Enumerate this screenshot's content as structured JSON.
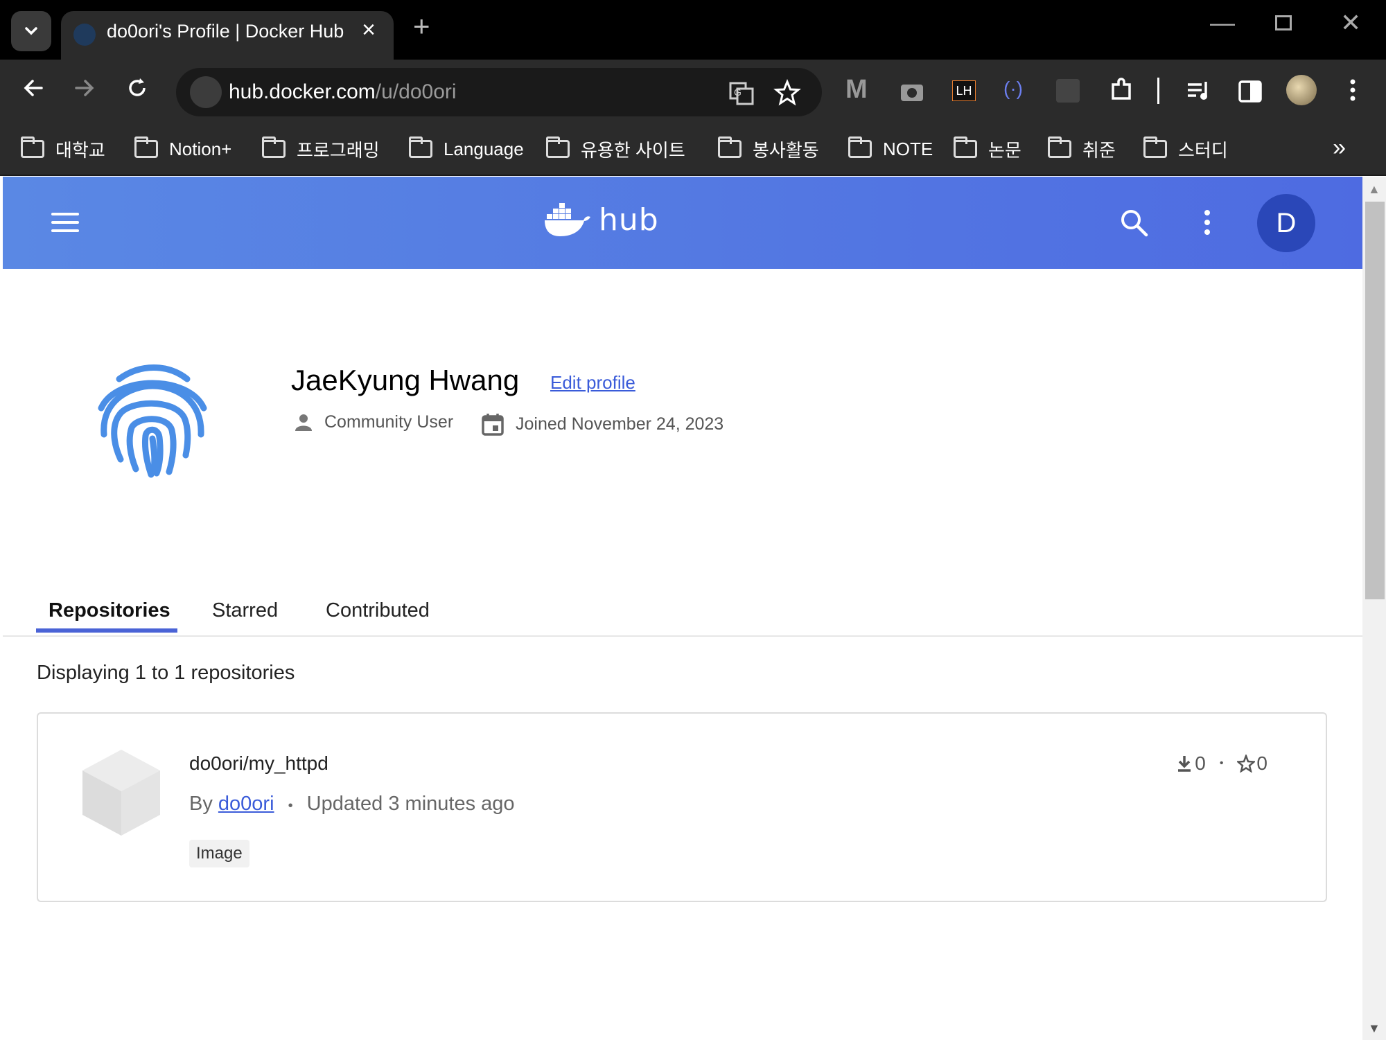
{
  "browser": {
    "tab_title": "do0ori's Profile | Docker Hub",
    "url_host": "hub.docker.com",
    "url_path": "/u/do0ori",
    "bookmarks": [
      "대학교",
      "Notion+",
      "프로그래밍",
      "Language",
      "유용한 사이트",
      "봉사활동",
      "NOTE",
      "논문",
      "취준",
      "스터디"
    ],
    "extensions": [
      "MW",
      "camera",
      "LH",
      "code",
      "bird",
      "puzzle",
      "media",
      "sidepanel",
      "profile"
    ]
  },
  "hub": {
    "logo_text": "hub",
    "avatar_letter": "D",
    "accent": "#4e6be1"
  },
  "profile": {
    "name": "JaeKyung Hwang",
    "edit_label": "Edit profile",
    "role": "Community User",
    "joined": "Joined November 24, 2023"
  },
  "tabs": [
    "Repositories",
    "Starred",
    "Contributed"
  ],
  "display_text": "Displaying 1 to 1 repositories",
  "repo": {
    "name": "do0ori/my_httpd",
    "by_label": "By",
    "owner": "do0ori",
    "updated": "Updated 3 minutes ago",
    "type_badge": "Image",
    "pulls": "0",
    "stars": "0"
  }
}
